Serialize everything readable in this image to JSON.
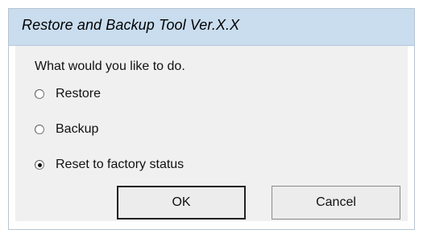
{
  "dialog": {
    "title": "Restore and Backup Tool Ver.X.X",
    "prompt": "What would you like to do.",
    "options": [
      {
        "label": "Restore",
        "selected": false
      },
      {
        "label": "Backup",
        "selected": false
      },
      {
        "label": "Reset to factory status",
        "selected": true
      }
    ],
    "buttons": {
      "ok": "OK",
      "cancel": "Cancel"
    }
  },
  "colors": {
    "titlebar": "#c9ddef",
    "content_bg": "#f0f0f0",
    "button_bg": "#ececec"
  }
}
